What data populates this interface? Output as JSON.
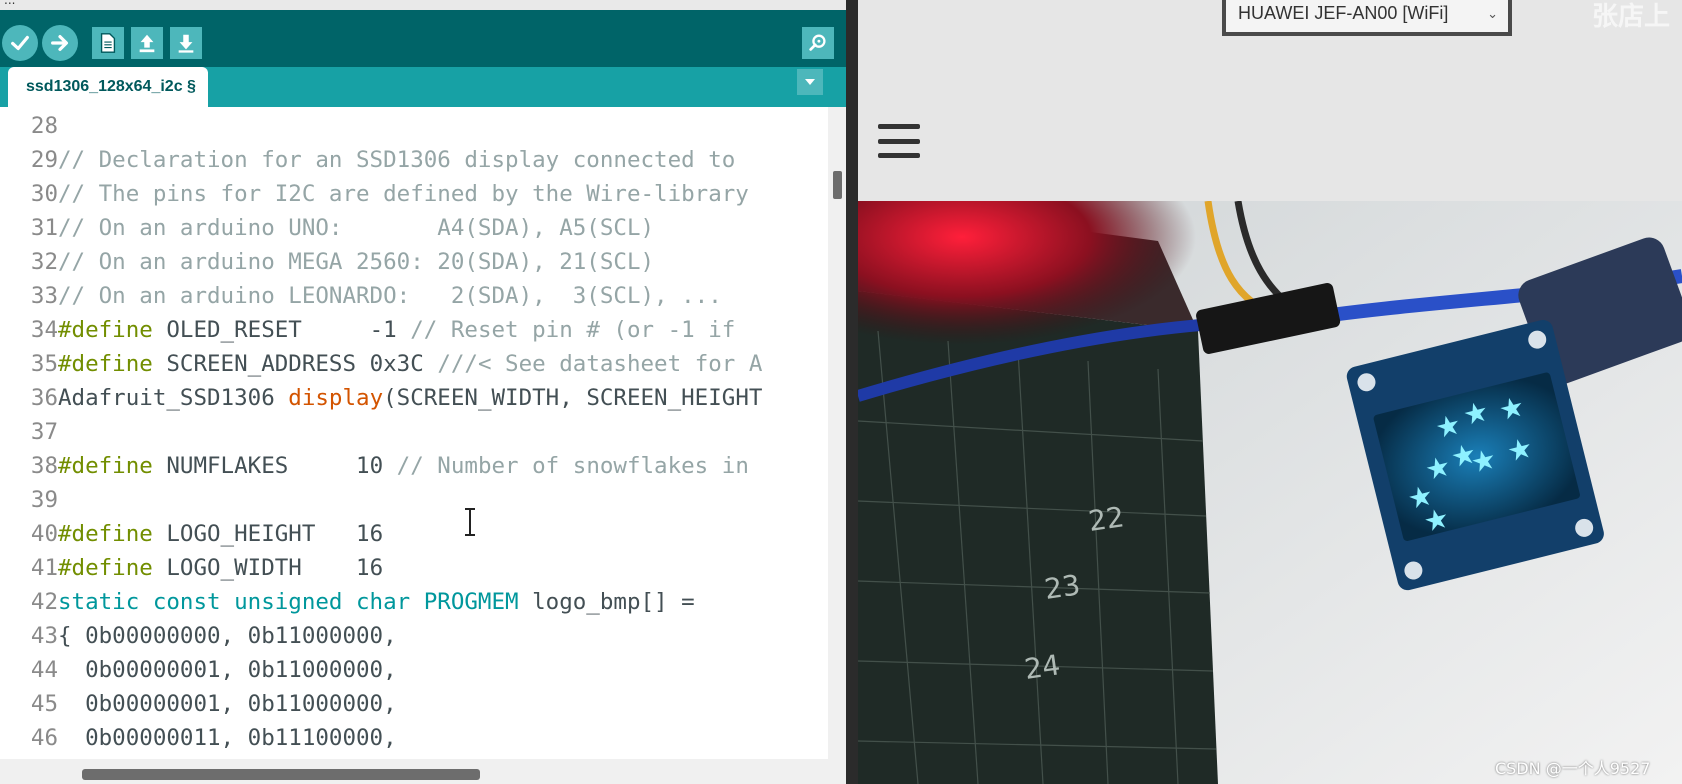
{
  "ide": {
    "window_title": "...",
    "tab_label": "ssd1306_128x64_i2c §",
    "toolbar": {
      "verify": "verify-icon",
      "upload": "upload-arrow-icon",
      "new": "new-file-icon",
      "open": "open-arrow-up-icon",
      "save": "save-arrow-down-icon",
      "serial_monitor": "magnifier-icon"
    },
    "code_lines": [
      {
        "num": "28",
        "tokens": []
      },
      {
        "num": "29",
        "tokens": [
          {
            "t": "// Declaration for an SSD1306 display connected to",
            "c": "c-comment"
          }
        ]
      },
      {
        "num": "30",
        "tokens": [
          {
            "t": "// The pins for I2C are defined by the Wire-library",
            "c": "c-comment"
          }
        ]
      },
      {
        "num": "31",
        "tokens": [
          {
            "t": "// On an arduino UNO:       A4(SDA), A5(SCL)",
            "c": "c-comment"
          }
        ]
      },
      {
        "num": "32",
        "tokens": [
          {
            "t": "// On an arduino MEGA 2560: 20(SDA), 21(SCL)",
            "c": "c-comment"
          }
        ]
      },
      {
        "num": "33",
        "tokens": [
          {
            "t": "// On an arduino LEONARDO:   2(SDA),  3(SCL), ...",
            "c": "c-comment"
          }
        ]
      },
      {
        "num": "34",
        "tokens": [
          {
            "t": "#define",
            "c": "c-define"
          },
          {
            "t": " OLED_RESET     -1 ",
            "c": "c-plain"
          },
          {
            "t": "// Reset pin # (or -1 if",
            "c": "c-comment"
          }
        ]
      },
      {
        "num": "35",
        "tokens": [
          {
            "t": "#define",
            "c": "c-define"
          },
          {
            "t": " SCREEN_ADDRESS 0x3C ",
            "c": "c-plain"
          },
          {
            "t": "///< See datasheet for A",
            "c": "c-comment"
          }
        ]
      },
      {
        "num": "36",
        "tokens": [
          {
            "t": "Adafruit_SSD1306 ",
            "c": "c-plain"
          },
          {
            "t": "display",
            "c": "c-fn"
          },
          {
            "t": "(SCREEN_WIDTH, SCREEN_HEIGHT",
            "c": "c-plain"
          }
        ]
      },
      {
        "num": "37",
        "tokens": []
      },
      {
        "num": "38",
        "tokens": [
          {
            "t": "#define",
            "c": "c-define"
          },
          {
            "t": " NUMFLAKES     10 ",
            "c": "c-plain"
          },
          {
            "t": "// Number of snowflakes in",
            "c": "c-comment"
          }
        ]
      },
      {
        "num": "39",
        "tokens": []
      },
      {
        "num": "40",
        "tokens": [
          {
            "t": "#define",
            "c": "c-define"
          },
          {
            "t": " LOGO_HEIGHT   16",
            "c": "c-plain"
          }
        ]
      },
      {
        "num": "41",
        "tokens": [
          {
            "t": "#define",
            "c": "c-define"
          },
          {
            "t": " LOGO_WIDTH    16",
            "c": "c-plain"
          }
        ]
      },
      {
        "num": "42",
        "tokens": [
          {
            "t": "static const unsigned char PROGMEM",
            "c": "c-kw"
          },
          {
            "t": " logo_bmp[] =",
            "c": "c-plain"
          }
        ]
      },
      {
        "num": "43",
        "tokens": [
          {
            "t": "{ 0b00000000, 0b11000000,",
            "c": "c-plain"
          }
        ]
      },
      {
        "num": "44",
        "tokens": [
          {
            "t": "  0b00000001, 0b11000000,",
            "c": "c-plain"
          }
        ]
      },
      {
        "num": "45",
        "tokens": [
          {
            "t": "  0b00000001, 0b11000000,",
            "c": "c-plain"
          }
        ]
      },
      {
        "num": "46",
        "tokens": [
          {
            "t": "  0b00000011, 0b11100000,",
            "c": "c-plain"
          }
        ]
      }
    ]
  },
  "right": {
    "wifi_select": "HUAWEI JEF-AN00 [WiFi]",
    "corner_text": "张店上",
    "menu_icon": "hamburger-menu-icon",
    "photo_text": [
      "22",
      "23",
      "24"
    ],
    "watermark": "CSDN @一个人9527"
  },
  "colors": {
    "toolbar": "#006468",
    "tabbar": "#17a1a5",
    "comment": "#95a5a6",
    "define": "#728e00",
    "keyword": "#00979c",
    "function": "#d35400"
  }
}
